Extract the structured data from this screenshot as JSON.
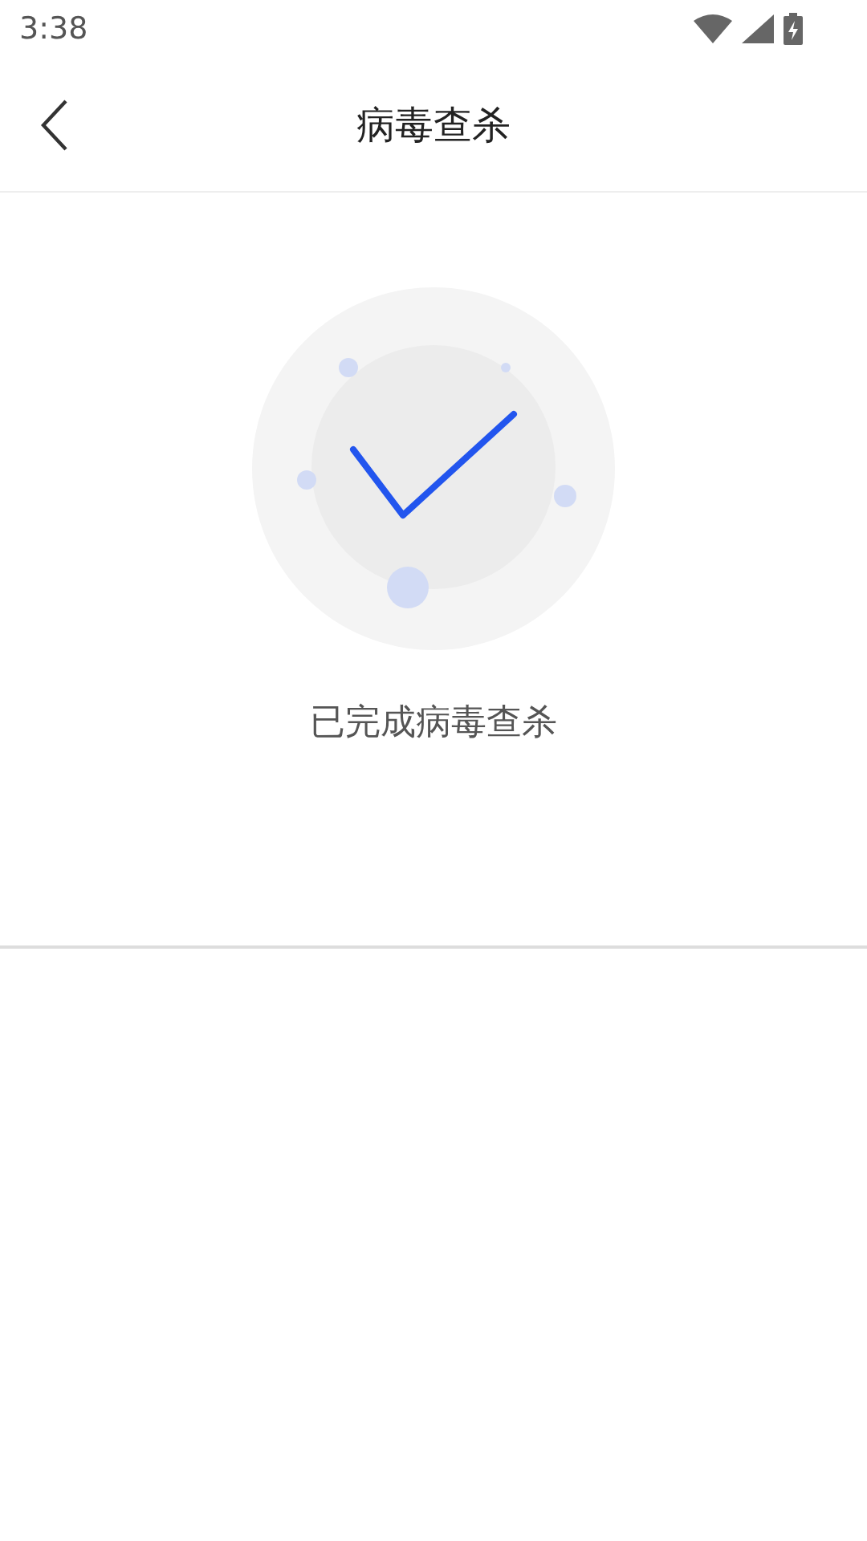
{
  "status_bar": {
    "time": "3:38"
  },
  "header": {
    "title": "病毒查杀"
  },
  "result": {
    "message": "已完成病毒查杀"
  }
}
